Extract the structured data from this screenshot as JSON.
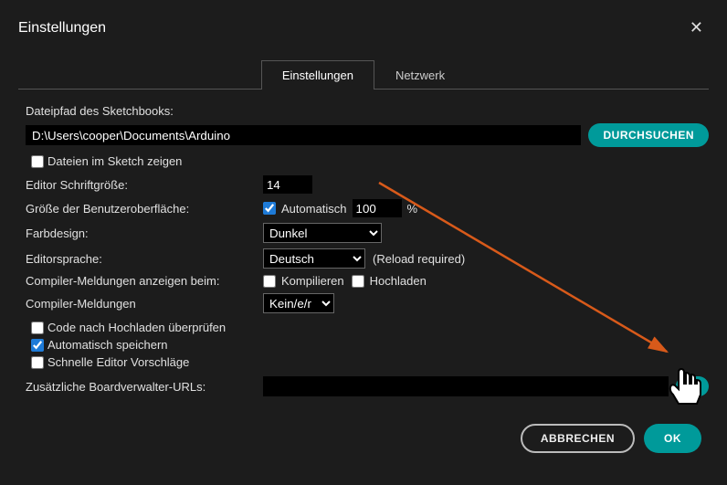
{
  "dialog": {
    "title": "Einstellungen"
  },
  "tabs": {
    "settings": "Einstellungen",
    "network": "Netzwerk"
  },
  "labels": {
    "sketchbook_path": "Dateipfad des Sketchbooks:",
    "show_files": "Dateien im Sketch zeigen",
    "font_size": "Editor Schriftgröße:",
    "ui_scale": "Größe der Benutzeroberfläche:",
    "auto": "Automatisch",
    "percent": "%",
    "theme": "Farbdesign:",
    "lang": "Editorsprache:",
    "reload": "(Reload required)",
    "compiler_show": "Compiler-Meldungen anzeigen beim:",
    "compile": "Kompilieren",
    "upload": "Hochladen",
    "compiler_msgs": "Compiler-Meldungen",
    "verify_after": "Code nach Hochladen überprüfen",
    "autosave": "Automatisch speichern",
    "quick_suggest": "Schnelle Editor Vorschläge",
    "board_urls": "Zusätzliche Boardverwalter-URLs:"
  },
  "values": {
    "sketchbook_path": "D:\\Users\\cooper\\Documents\\Arduino",
    "font_size": "14",
    "ui_scale": "100",
    "theme": "Dunkel",
    "lang": "Deutsch",
    "compiler_msgs": "Kein/e/r",
    "board_urls": ""
  },
  "buttons": {
    "browse": "DURCHSUCHEN",
    "cancel": "ABBRECHEN",
    "ok": "OK"
  }
}
